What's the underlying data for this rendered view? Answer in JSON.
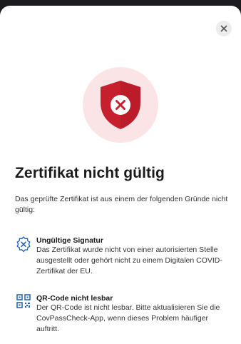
{
  "dialog": {
    "close_icon": "close-icon",
    "hero_icon": "shield-x-icon",
    "title": "Zertifikat nicht gültig",
    "intro": "Das geprüfte Zertifikat ist aus einem der folgenden Gründe nicht gültig:",
    "reasons": [
      {
        "icon": "invalid-signature-icon",
        "title": "Ungültige Signatur",
        "description": "Das Zertifikat wurde nicht von einer autorisierten Stelle ausgestellt oder gehört nicht zu einem Digitalen COVID-Zertifikat der EU."
      },
      {
        "icon": "qr-code-icon",
        "title": "QR-Code nicht lesbar",
        "description": "Der QR-Code ist nicht lesbar. Bitte aktualisieren Sie die CovPassCheck-App, wenn dieses Problem häufiger auftritt."
      }
    ]
  },
  "colors": {
    "accent_blue": "#1f5fb0",
    "shield_red": "#c6202f",
    "hero_bg": "#fbe4e6"
  }
}
